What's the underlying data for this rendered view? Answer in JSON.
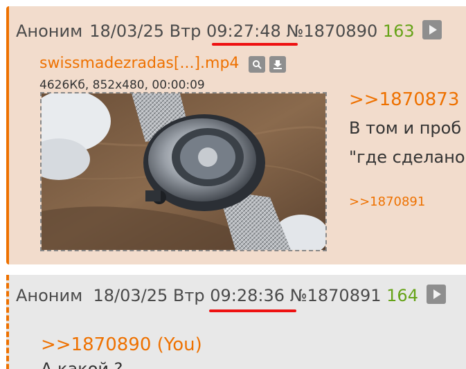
{
  "post1": {
    "author": "Аноним",
    "date": "18/03/25",
    "weekday": "Втр",
    "time": "09:27:48",
    "number": "№1870890",
    "reply_count": "163",
    "file": {
      "name": "swissmadezradas[...].mp4",
      "meta": "4626Кб, 852x480, 00:00:09",
      "search_icon": "search-icon",
      "download_icon": "download-icon"
    },
    "quote_link": ">>1870873",
    "text_line1": "В том и проб",
    "text_line2": "\"где сделано",
    "reply_link": ">>1870891"
  },
  "post2": {
    "author": "Аноним",
    "date": "18/03/25",
    "weekday": "Втр",
    "time": "09:28:36",
    "number": "№1870891",
    "reply_count": "164",
    "quote_link": ">>1870890 (You)",
    "text_cut": "А какой                                          ?"
  },
  "colors": {
    "accent": "#ee7100",
    "highlight": "#ee1111",
    "reply_count": "#66a318",
    "post_bg_op": "#f2dccc",
    "post_bg": "#e8e8e8"
  }
}
